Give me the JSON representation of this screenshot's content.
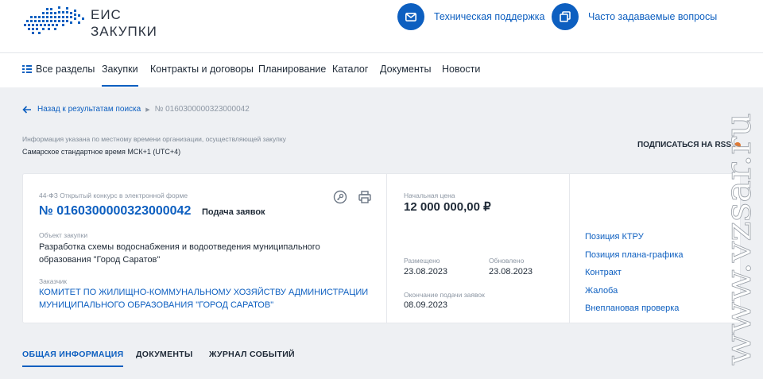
{
  "header": {
    "logo_line1": "ЕИС",
    "logo_line2": "ЗАКУПКИ",
    "support_label": "Техническая поддержка",
    "faq_label": "Часто задаваемые вопросы"
  },
  "nav": {
    "all_sections": "Все разделы",
    "items": [
      "Закупки",
      "Контракты и договоры",
      "Планирование",
      "Каталог",
      "Документы",
      "Новости"
    ]
  },
  "breadcrumb": {
    "back": "Назад к результатам поиска",
    "current": "№ 0160300000323000042"
  },
  "timezone": {
    "note": "Информация указана по местному времени организации, осуществляющей закупку",
    "value": "Самарское стандартное время МСК+1 (UTC+4)"
  },
  "rss": {
    "label": "ПОДПИСАТЬСЯ НА RSS"
  },
  "procurement": {
    "type": "44-ФЗ Открытый конкурс в электронной форме",
    "number": "№ 0160300000323000042",
    "status": "Подача заявок",
    "object_label": "Объект закупки",
    "object": "Разработка схемы водоснабжения и водоотведения муниципального образования \"Город Саратов\"",
    "customer_label": "Заказчик",
    "customer": "КОМИТЕТ ПО ЖИЛИЩНО-КОММУНАЛЬНОМУ ХОЗЯЙСТВУ АДМИНИСТРАЦИИ МУНИЦИПАЛЬНОГО ОБРАЗОВАНИЯ \"ГОРОД САРАТОВ\"",
    "price_label": "Начальная цена",
    "price": "12 000 000,00 ₽",
    "placed_label": "Размещено",
    "placed": "23.08.2023",
    "updated_label": "Обновлено",
    "updated": "23.08.2023",
    "deadline_label": "Окончание подачи заявок",
    "deadline": "08.09.2023"
  },
  "side_links": [
    "Позиция КТРУ",
    "Позиция плана-графика",
    "Контракт",
    "Жалоба",
    "Внеплановая проверка"
  ],
  "tabs": [
    "ОБЩАЯ ИНФОРМАЦИЯ",
    "ДОКУМЕНТЫ",
    "ЖУРНАЛ СОБЫТИЙ"
  ],
  "watermark": "www.vzsar.ru",
  "colors": {
    "accent": "#0d5fc0",
    "rss": "#e07a35"
  }
}
